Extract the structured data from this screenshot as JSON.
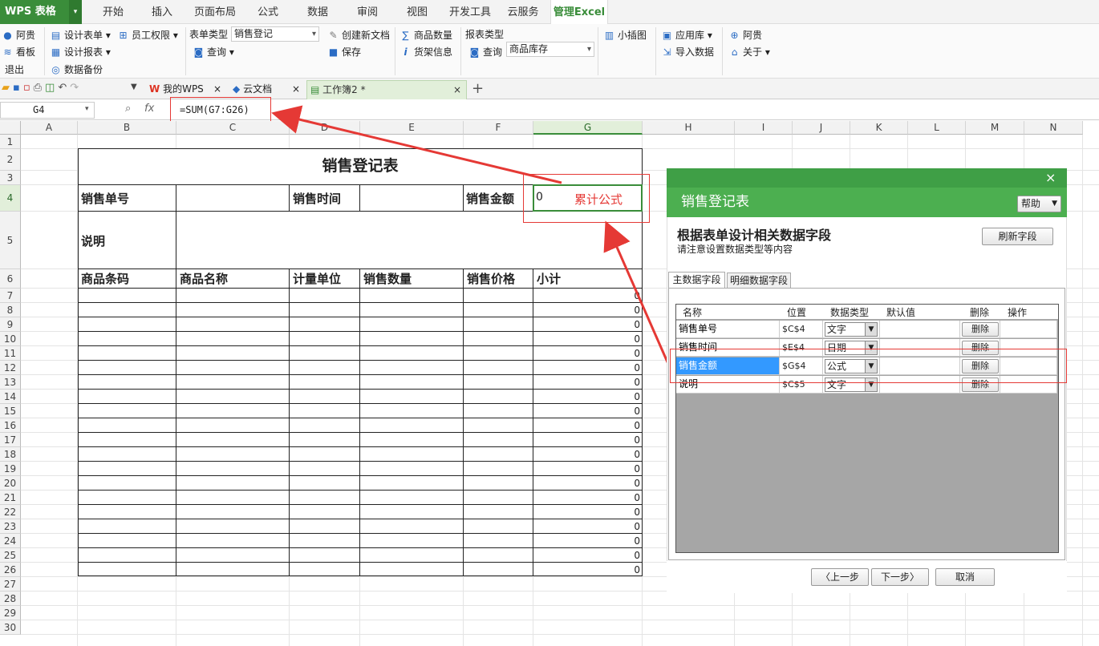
{
  "app": {
    "name": "WPS 表格"
  },
  "menu": {
    "tabs": [
      "开始",
      "插入",
      "页面布局",
      "公式",
      "数据",
      "审阅",
      "视图",
      "开发工具",
      "云服务",
      "管理Excel"
    ]
  },
  "ribbon": {
    "user": "阿贵",
    "board": "看板",
    "logout": "退出",
    "design_form": "设计表单",
    "design_report": "设计报表",
    "backup": "数据备份",
    "staff_perm": "员工权限",
    "form_type_label": "表单类型",
    "form_type_value": "销售登记",
    "query": "查询",
    "new_doc": "创建新文档",
    "save": "保存",
    "goods_qty": "商品数量",
    "shelf_info": "货架信息",
    "report_type_label": "报表类型",
    "report_type_value": "商品库存",
    "report_query": "查询",
    "mini_chart": "小插图",
    "app_store": "应用库",
    "import": "导入数据",
    "user2": "阿贵",
    "about": "关于"
  },
  "doc_tabs": {
    "my_wps": "我的WPS",
    "cloud": "云文档",
    "workbook": "工作簿2 *"
  },
  "formula_bar": {
    "cell_ref": "G4",
    "fx": "fx",
    "formula": "=SUM(G7:G26)"
  },
  "columns": [
    "A",
    "B",
    "C",
    "D",
    "E",
    "F",
    "G",
    "H",
    "I",
    "J",
    "K",
    "L",
    "M",
    "N"
  ],
  "rows": [
    "1",
    "2",
    "3",
    "4",
    "5",
    "6",
    "7",
    "8",
    "9",
    "10",
    "11",
    "12",
    "13",
    "14",
    "15",
    "16",
    "17",
    "18",
    "19",
    "20",
    "21",
    "22",
    "23",
    "24",
    "25",
    "26",
    "27",
    "28",
    "29",
    "30"
  ],
  "sheet": {
    "title": "销售登记表",
    "sale_no": "销售单号",
    "sale_time": "销售时间",
    "sale_amount": "销售金额",
    "amount_value": "0",
    "annotation": "累计公式",
    "note": "说明",
    "headers": [
      "商品条码",
      "商品名称",
      "计量单位",
      "销售数量",
      "销售价格",
      "小计"
    ],
    "subtotals": [
      "0",
      "0",
      "0",
      "0",
      "0",
      "0",
      "0",
      "0",
      "0",
      "0",
      "0",
      "0",
      "0",
      "0",
      "0",
      "0",
      "0",
      "0",
      "0",
      "0"
    ]
  },
  "dialog": {
    "close": "×",
    "title": "销售登记表",
    "help": "帮助",
    "heading": "根据表单设计相关数据字段",
    "subheading": "请注意设置数据类型等内容",
    "refresh": "刷新字段",
    "tab_main": "主数据字段",
    "tab_detail": "明细数据字段",
    "grid_headers": [
      "名称",
      "位置",
      "数据类型",
      "默认值",
      "删除",
      "操作"
    ],
    "rows": [
      {
        "name": "销售单号",
        "pos": "$C$4",
        "type": "文字",
        "delete": "删除"
      },
      {
        "name": "销售时间",
        "pos": "$E$4",
        "type": "日期",
        "delete": "删除"
      },
      {
        "name": "销售金额",
        "pos": "$G$4",
        "type": "公式",
        "delete": "删除"
      },
      {
        "name": "说明",
        "pos": "$C$5",
        "type": "文字",
        "delete": "删除"
      }
    ],
    "prev": "上一步",
    "next": "下一步",
    "cancel": "取消"
  },
  "colors": {
    "wps_green": "#3a8d3a",
    "dialog_green": "#4caf50",
    "annotation_red": "#e53935",
    "selection_blue": "#3399ff"
  }
}
